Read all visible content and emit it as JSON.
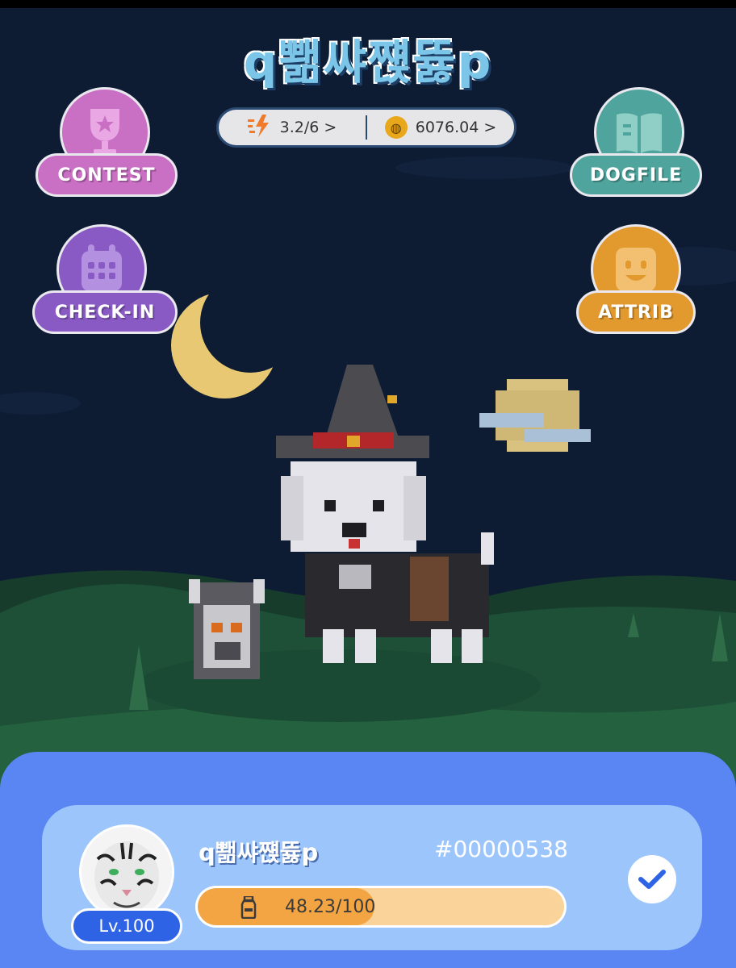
{
  "header": {
    "title": "q뾂쌰쨵뜛p",
    "energy_text": "3.2/6 >",
    "coins_text": "6076.04 >",
    "energy_icon": "lightning-icon",
    "coin_icon": "coin-icon"
  },
  "menu": {
    "contest": {
      "label": "CONTEST",
      "icon": "trophy-icon",
      "color": "#c96fc4"
    },
    "checkin": {
      "label": "CHECK-IN",
      "icon": "calendar-icon",
      "color": "#8a5ac4"
    },
    "dogfile": {
      "label": "DOGFILE",
      "icon": "book-icon",
      "color": "#4fa59d"
    },
    "attrib": {
      "label": "ATTRIB",
      "icon": "smiley-icon",
      "color": "#e2992e"
    }
  },
  "profile": {
    "name": "q뾂쌰쨵뜛p",
    "id": "#00000538",
    "level": "Lv.100",
    "exp_text": "48.23/100",
    "exp_fraction": 0.4823,
    "avatar": "white-tiger-avatar",
    "action_icon": "checkmark-icon"
  },
  "colors": {
    "sky": "#0d1b33",
    "hill": "#1b4a34",
    "panel": "#5a86f4",
    "card": "#9cc6fb",
    "exp_fill": "#f3a543"
  }
}
